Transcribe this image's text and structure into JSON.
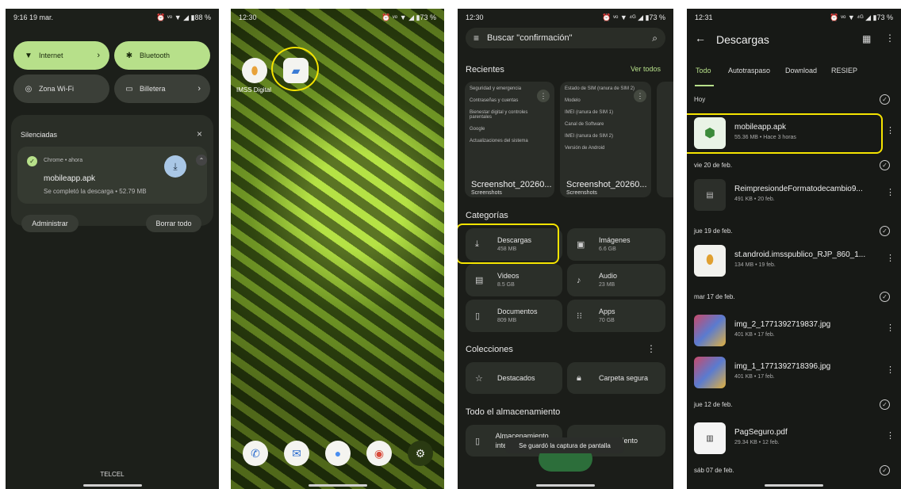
{
  "colors": {
    "accent": "#b7e08a",
    "highlight": "#f5e400",
    "background": "#1b1d19"
  },
  "p1": {
    "status": {
      "time": "9:16  19 mar.",
      "right": "⏰ ᵛᵒ ▼ ◢ ▮88 %"
    },
    "tiles": {
      "internet": "Internet",
      "bluetooth": "Bluetooth",
      "hotspot": "Zona Wi-Fi",
      "wallet": "Billetera"
    },
    "notif_header": "Silenciadas",
    "notif_close": "×",
    "notif_app": "Chrome • ahora",
    "notif_title": "mobileapp.apk",
    "notif_body": "Se completó la descarga • 52.79 MB",
    "btn_manage": "Administrar",
    "btn_clear": "Borrar todo",
    "carrier": "TELCEL"
  },
  "p2": {
    "status": {
      "time": "12:30",
      "right": "⏰ ᵛᵒ ▼ ◢ ▮73 %"
    },
    "app_label": "IMSS Digital"
  },
  "p3": {
    "status": {
      "time": "12:30",
      "right": "⏰ ᵛᵒ ▼ ⁴ᴳ ◢ ▮73 %"
    },
    "search": "Buscar \"confirmación\"",
    "recientes": "Recientes",
    "ver_todos": "Ver todos",
    "thumb1_lines": [
      "Seguridad y emergencia",
      "Contraseñas y cuentas",
      "Bienestar digital y controles parentales",
      "Google",
      "Actualizaciones del sistema"
    ],
    "thumb2_lines": [
      "Estado de SIM (ranura de SIM 2)",
      "Modelo",
      "IMEI (ranura de SIM 1)",
      "Canal de Software",
      "IMEI (ranura de SIM 2)",
      "Versión de Android"
    ],
    "thumb_caption": "Screenshot_20260...",
    "thumb_sub": "Screenshots",
    "categorias": "Categorías",
    "categories": [
      {
        "label": "Descargas",
        "size": "458 MB"
      },
      {
        "label": "Imágenes",
        "size": "6.6 GB"
      },
      {
        "label": "Videos",
        "size": "8.5 GB"
      },
      {
        "label": "Audio",
        "size": "23 MB"
      },
      {
        "label": "Documentos",
        "size": "809 MB"
      },
      {
        "label": "Apps",
        "size": "70 GB"
      }
    ],
    "colecciones": "Colecciones",
    "destacados": "Destacados",
    "carpeta_segura": "Carpeta segura",
    "todo_almacenamiento": "Todo el almacenamiento",
    "storage_left": "Almacenamiento interno",
    "storage_right": "Almacenamiento",
    "toast": "Se guardó la captura de pantalla"
  },
  "p4": {
    "status": {
      "time": "12:31",
      "right": "⏰ ᵛᵒ ▼ ⁴ᴳ ◢ ▮73 %"
    },
    "title": "Descargas",
    "tabs": [
      "Todo",
      "Autotraspaso",
      "Download",
      "RESIEP"
    ],
    "groups": [
      "Hoy",
      "vie 20 de feb.",
      "jue 19 de feb.",
      "mar 17 de feb.",
      "jue 12 de feb.",
      "sáb 07 de feb."
    ],
    "files": [
      {
        "name": "mobileapp.apk",
        "meta": "55.36 MB • Hace 3 horas"
      },
      {
        "name": "ReimpresiondeFormatodecambio9...",
        "meta": "491 KB • 20 feb."
      },
      {
        "name": "st.android.imsspublico_RJP_860_1...",
        "meta": "134 MB • 19 feb."
      },
      {
        "name": "img_2_1771392719837.jpg",
        "meta": "401 KB • 17 feb."
      },
      {
        "name": "img_1_1771392718396.jpg",
        "meta": "401 KB • 17 feb."
      },
      {
        "name": "PagSeguro.pdf",
        "meta": "29.34 KB • 12 feb."
      }
    ]
  }
}
